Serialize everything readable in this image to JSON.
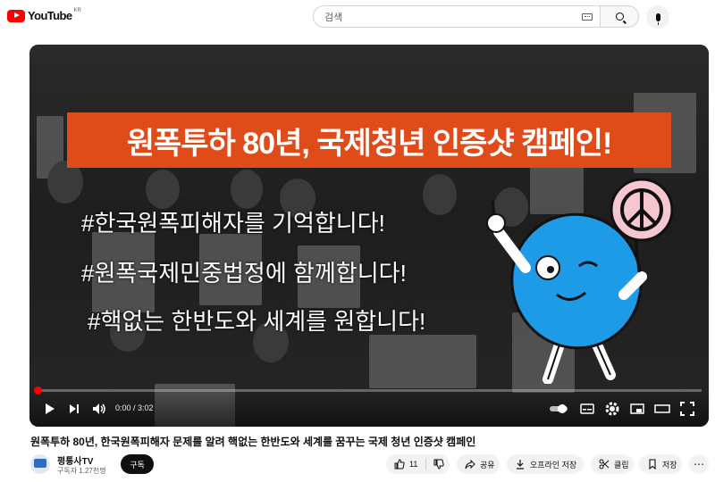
{
  "header": {
    "logo_text": "YouTube",
    "country_code": "KR",
    "search_placeholder": "검색"
  },
  "video": {
    "banner_title": "원폭투하 80년, 국제청년 인증샷 캠페인!",
    "lines": [
      "#한국원폭피해자를 기억합니다!",
      "#원폭국제민중법정에 함께합니다!",
      "#핵없는 한반도와 세계를 원합니다!"
    ],
    "time_current": "0:00",
    "time_total": "3:02",
    "progress_fraction": 0.0,
    "colors": {
      "banner": "#e04b1a",
      "progress": "#ff0000"
    }
  },
  "details": {
    "title": "원폭투하 80년, 한국원폭피해자 문제를 알려 핵없는 한반도와 세계를 꿈꾸는 국제 청년 인증샷 캠페인",
    "channel_name": "평통사TV",
    "subscribers": "구독자 1.27천명",
    "subscribe_label": "구독",
    "like_count": "11",
    "share_label": "공유",
    "offline_label": "오프라인 저장",
    "clip_label": "클립",
    "save_label": "저장"
  }
}
